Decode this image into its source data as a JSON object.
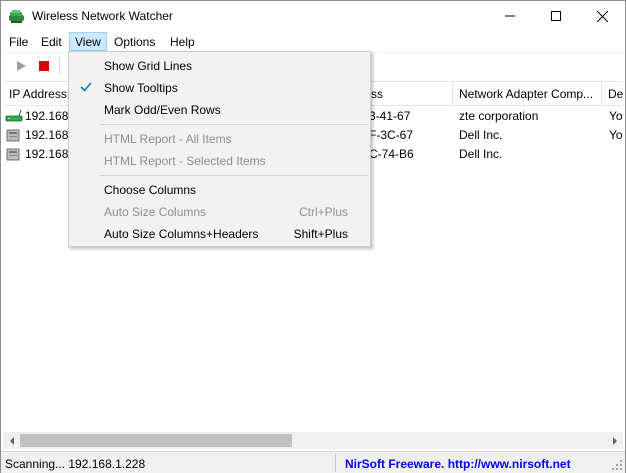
{
  "window": {
    "title": "Wireless Network Watcher",
    "icon": "network-watcher-app-icon"
  },
  "menubar": {
    "items": [
      {
        "label": "File"
      },
      {
        "label": "Edit"
      },
      {
        "label": "View"
      },
      {
        "label": "Options"
      },
      {
        "label": "Help"
      }
    ],
    "active": "View"
  },
  "toolbar": {
    "buttons": [
      {
        "icon": "play-icon",
        "color": "#9e9e9e"
      },
      {
        "icon": "stop-icon",
        "color": "#e00000"
      }
    ]
  },
  "table": {
    "columns": [
      {
        "label": "IP Address"
      },
      {
        "label": "ss"
      },
      {
        "label": "Network Adapter Comp..."
      },
      {
        "label": "Dev"
      }
    ],
    "rows": [
      {
        "icon": "router-icon",
        "ip": "192.168.",
        "mac": "3-41-67",
        "vendor": "zte corporation",
        "device": "You"
      },
      {
        "icon": "computer-icon",
        "ip": "192.168.",
        "mac": "F-3C-67",
        "vendor": "Dell Inc.",
        "device": "You"
      },
      {
        "icon": "computer-icon",
        "ip": "192.168.",
        "mac": "C-74-B6",
        "vendor": "Dell Inc.",
        "device": ""
      }
    ]
  },
  "view_menu": {
    "items": [
      {
        "label": "Show Grid Lines",
        "shortcut": "",
        "checked": false,
        "enabled": true
      },
      {
        "label": "Show Tooltips",
        "shortcut": "",
        "checked": true,
        "enabled": true
      },
      {
        "label": "Mark Odd/Even Rows",
        "shortcut": "",
        "checked": false,
        "enabled": true
      },
      {
        "label": "HTML Report - All Items",
        "shortcut": "",
        "checked": false,
        "enabled": false
      },
      {
        "label": "HTML Report - Selected Items",
        "shortcut": "",
        "checked": false,
        "enabled": false
      },
      {
        "label": "Choose Columns",
        "shortcut": "",
        "checked": false,
        "enabled": true
      },
      {
        "label": "Auto Size Columns",
        "shortcut": "Ctrl+Plus",
        "checked": false,
        "enabled": false
      },
      {
        "label": "Auto Size Columns+Headers",
        "shortcut": "Shift+Plus",
        "checked": false,
        "enabled": true
      }
    ]
  },
  "statusbar": {
    "left": "Scanning... 192.168.1.228",
    "right": "NirSoft Freeware.  http://www.nirsoft.net",
    "link_color": "#0000ff"
  },
  "colors": {
    "menu_highlight": "#cce8ff",
    "disabled_text": "#8d8d8d",
    "check": "#0078d7"
  }
}
